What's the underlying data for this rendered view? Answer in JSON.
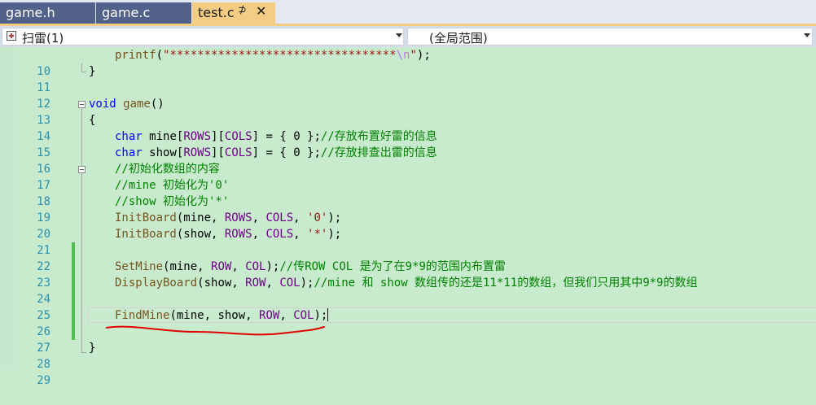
{
  "tabs": [
    {
      "label": "game.h",
      "active": false
    },
    {
      "label": "game.c",
      "active": false
    },
    {
      "label": "test.c",
      "active": true,
      "pin": "⊅",
      "close": "✕"
    }
  ],
  "nav": {
    "project": "扫雷(1)",
    "scope": "(全局范围)"
  },
  "editor": {
    "line_numbers": [
      "10",
      "11",
      "12",
      "13",
      "14",
      "15",
      "16",
      "17",
      "18",
      "19",
      "20",
      "21",
      "22",
      "23",
      "24",
      "25",
      "26",
      "27",
      "28",
      "29"
    ],
    "tokens": {
      "printf": "printf",
      "lparen": "(",
      "printf_str": "\"*********************************",
      "printf_esc": "\\n",
      "printf_close": "\"",
      "rparen_semi": ");",
      "rbrace": "}",
      "lbrace": "{",
      "void": "void",
      "game": "game",
      "parens": "()",
      "char": "char",
      "mine": "mine",
      "show": "show",
      "rows": "ROWS",
      "cols": "COLS",
      "row": "ROW",
      "col": "COL",
      "lbr": "[",
      "rbr_lbr": "][",
      "rbr": "]",
      "assign_init": " = { 0 };",
      "comma_sp": ", ",
      "sp": " ",
      "paren_open": "(",
      "paren_close_semi": ");",
      "char_zero": "'0'",
      "char_star": "'*'",
      "init_board": "InitBoard",
      "set_mine": "SetMine",
      "display_board": "DisplayBoard",
      "find_mine": "FindMine"
    },
    "comments": {
      "l15": "//存放布置好雷的信息",
      "l16": "//存放排查出雷的信息",
      "l17": "//初始化数组的内容",
      "l18": "//mine 初始化为'0'",
      "l19": "//show 初始化为'*'",
      "l23": "//传ROW COL 是为了在9*9的范围内布置雷",
      "l24": "//mine 和 show 数组传的还是11*11的数组，但我们只用其中9*9的数组"
    }
  },
  "colors": {
    "editor_bg": "#c7ebcc",
    "tab_inactive": "#52618a",
    "tab_active": "#f5cc84",
    "keyword": "#0000ff",
    "function": "#74531f",
    "macro": "#6f008a",
    "comment": "#008000",
    "string": "#a31515",
    "line_number": "#2b91af",
    "annotation": "#e00000"
  }
}
